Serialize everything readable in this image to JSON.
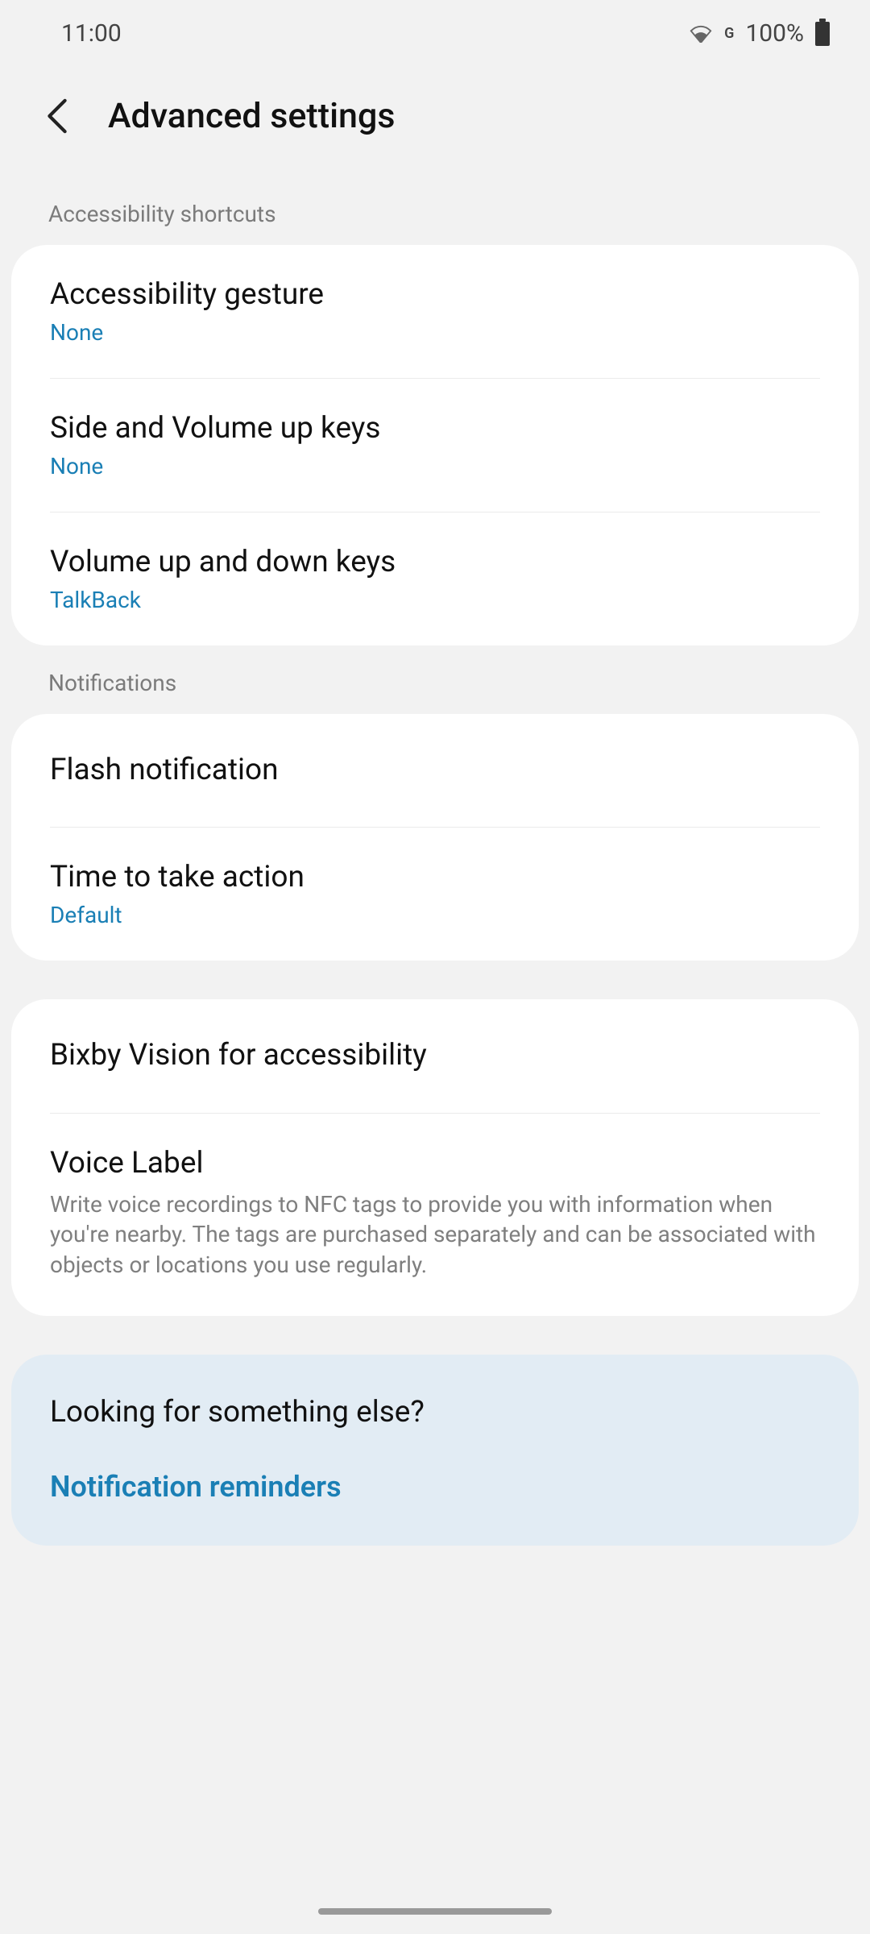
{
  "status": {
    "time": "11:00",
    "network_label": "G",
    "battery": "100%"
  },
  "header": {
    "title": "Advanced settings"
  },
  "sections": {
    "shortcuts": {
      "header": "Accessibility shortcuts",
      "items": [
        {
          "title": "Accessibility gesture",
          "value": "None"
        },
        {
          "title": "Side and Volume up keys",
          "value": "None"
        },
        {
          "title": "Volume up and down keys",
          "value": "TalkBack"
        }
      ]
    },
    "notifications": {
      "header": "Notifications",
      "items": [
        {
          "title": "Flash notification"
        },
        {
          "title": "Time to take action",
          "value": "Default"
        }
      ]
    },
    "other": {
      "items": [
        {
          "title": "Bixby Vision for accessibility"
        },
        {
          "title": "Voice Label",
          "description": "Write voice recordings to NFC tags to provide you with information when you're nearby. The tags are purchased separately and can be associated with objects or locations you use regularly."
        }
      ]
    },
    "footer": {
      "title": "Looking for something else?",
      "link": "Notification reminders"
    }
  }
}
